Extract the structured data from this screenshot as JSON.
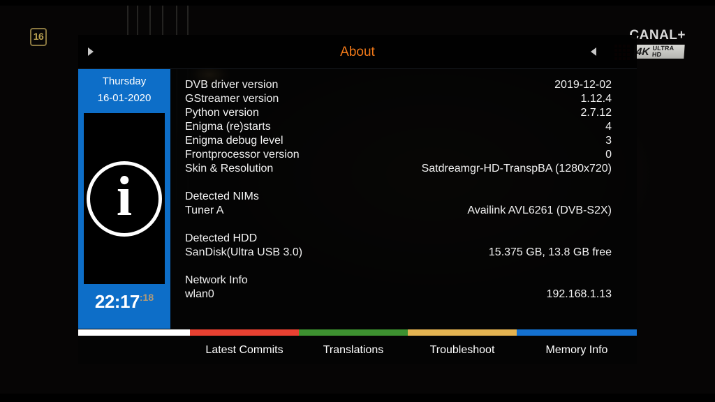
{
  "osd": {
    "age_rating": "16",
    "channel_logo": {
      "wordmark": "CANAL+",
      "badge_4k": "4K",
      "badge_uhd": "ULTRA HD"
    }
  },
  "window": {
    "title": "About",
    "nav_prev_icon": "triangle-right-icon",
    "nav_next_icon": "triangle-left-icon"
  },
  "sidebar": {
    "day": "Thursday",
    "date": "16-01-2020",
    "icon": "info-circle-icon",
    "icon_glyph": "i",
    "clock_time": "22:17",
    "clock_seconds": ":18"
  },
  "info_rows": [
    {
      "label": "DVB driver version",
      "value": "2019-12-02"
    },
    {
      "label": "GStreamer version",
      "value": "1.12.4"
    },
    {
      "label": "Python version",
      "value": "2.7.12"
    },
    {
      "label": "Enigma (re)starts",
      "value": "4"
    },
    {
      "label": "Enigma debug level",
      "value": "3"
    },
    {
      "label": "Frontprocessor version",
      "value": "0"
    },
    {
      "label": "Skin & Resolution",
      "value": "Satdreamgr-HD-TranspBA (1280x720)"
    },
    {
      "label": "",
      "value": ""
    },
    {
      "label": "Detected NIMs",
      "value": ""
    },
    {
      "label": "Tuner A",
      "value": "Availink AVL6261 (DVB-S2X)"
    },
    {
      "label": "",
      "value": ""
    },
    {
      "label": "Detected HDD",
      "value": ""
    },
    {
      "label": "SanDisk(Ultra USB 3.0)",
      "value": "15.375 GB, 13.8 GB free"
    },
    {
      "label": "",
      "value": ""
    },
    {
      "label": "Network Info",
      "value": ""
    },
    {
      "label": "wlan0",
      "value": "192.168.1.13"
    }
  ],
  "footer": {
    "buttons": [
      {
        "label": "",
        "color": "#ffffff"
      },
      {
        "label": "Latest Commits",
        "color": "#e84132"
      },
      {
        "label": "Translations",
        "color": "#3d9130"
      },
      {
        "label": "Troubleshoot",
        "color": "#e3b351"
      },
      {
        "label": "Memory Info",
        "color": "#1471d0"
      }
    ]
  },
  "colors": {
    "title_orange": "#f07818",
    "sidebar_blue": "#0d6ec8",
    "text_white": "#f2f2f2"
  }
}
